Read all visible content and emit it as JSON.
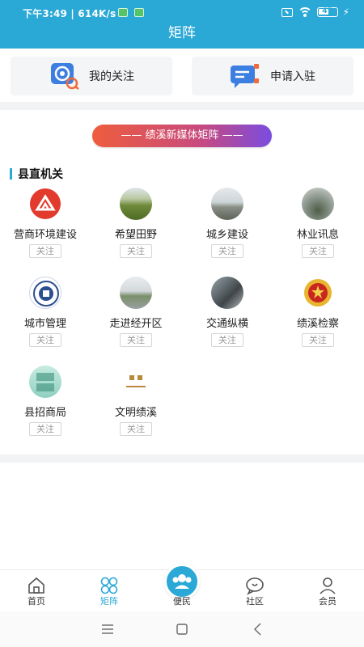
{
  "status_bar": {
    "time": "下午3:49 | 614K/s",
    "battery": "47"
  },
  "header": {
    "title": "矩阵"
  },
  "quick_actions": [
    {
      "label": "我的关注",
      "icon": "target-search-icon"
    },
    {
      "label": "申请入驻",
      "icon": "chat-apply-icon"
    }
  ],
  "banner": {
    "text": "—— 绩溪新媒体矩阵 ——"
  },
  "section": {
    "title": "县直机关"
  },
  "follow_label": "关注",
  "accounts": [
    {
      "name": "营商环境建设",
      "avatar": "business-logo-icon"
    },
    {
      "name": "希望田野",
      "avatar": "field-photo"
    },
    {
      "name": "城乡建设",
      "avatar": "road-photo"
    },
    {
      "name": "林业讯息",
      "avatar": "forest-photo"
    },
    {
      "name": "城市管理",
      "avatar": "city-emblem-icon"
    },
    {
      "name": "走进经开区",
      "avatar": "street-photo"
    },
    {
      "name": "交通纵横",
      "avatar": "highway-photo"
    },
    {
      "name": "绩溪检察",
      "avatar": "procuratorate-emblem-icon"
    },
    {
      "name": "县招商局",
      "avatar": "investment-logo-icon"
    },
    {
      "name": "文明绩溪",
      "avatar": "civilization-logo-icon"
    }
  ],
  "tabbar": [
    {
      "label": "首页",
      "icon": "home-icon"
    },
    {
      "label": "矩阵",
      "icon": "matrix-icon",
      "active": true
    },
    {
      "label": "便民",
      "icon": "people-icon"
    },
    {
      "label": "社区",
      "icon": "community-chat-icon"
    },
    {
      "label": "会员",
      "icon": "user-icon"
    }
  ],
  "colors": {
    "primary": "#2aa8d6",
    "banner_start": "#ee5d3d",
    "banner_end": "#7a4ce0"
  }
}
